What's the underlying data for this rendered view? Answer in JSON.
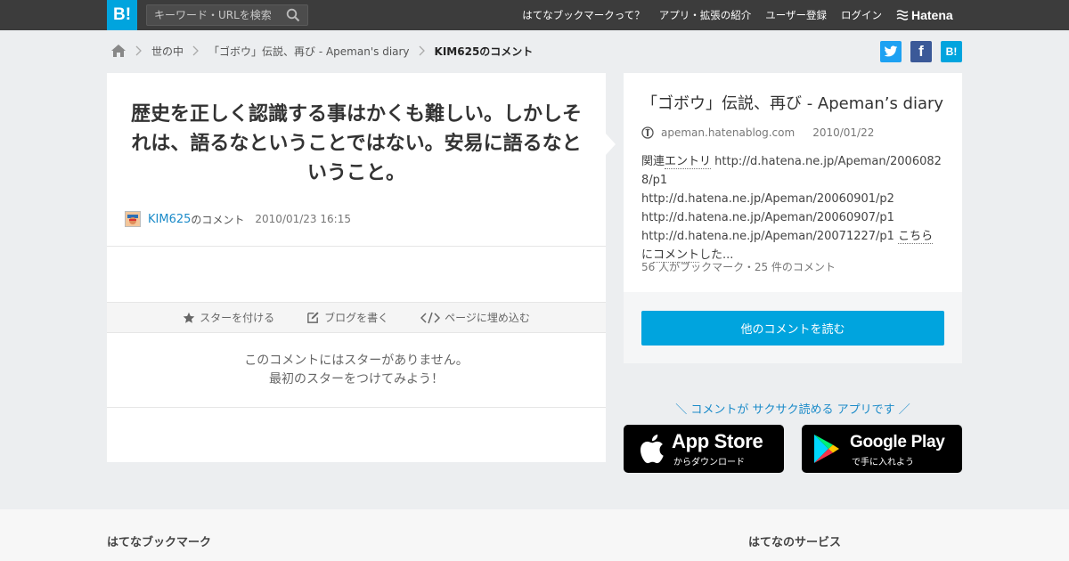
{
  "header": {
    "logo": "B!",
    "search_placeholder": "キーワード・URLを検索",
    "nav": [
      "はてなブックマークって？",
      "アプリ・拡張の紹介",
      "ユーザー登録",
      "ログイン"
    ],
    "brand": "Hatena"
  },
  "breadcrumb": {
    "items": [
      "世の中",
      "「ゴボウ」伝説、再び - Apeman's diary"
    ],
    "current": "KIM625のコメント"
  },
  "share": {
    "twitter": "twitter-icon",
    "facebook_label": "f",
    "hatebu_label": "B!"
  },
  "comment": {
    "text": "歴史を正しく認識する事はかくも難しい。しかしそれは、語るなということではない。安易に語るなということ。",
    "username": "KIM625",
    "suffix": "のコメント",
    "date": "2010/01/23 16:15"
  },
  "actions": {
    "star": "スターを付ける",
    "blog": "ブログを書く",
    "embed": "ページに埋め込む"
  },
  "nostar": {
    "line1": "このコメントにはスターがありません。",
    "line2": "最初のスターをつけてみよう！"
  },
  "entry": {
    "title": "「ゴボウ」伝説、再び - Apeman’s diary",
    "domain": "apeman.hatenablog.com",
    "date": "2010/01/22",
    "body": {
      "kw_related_prefix": "関連",
      "kw_entry": "エントリ",
      "url1": " http://d.hatena.ne.jp/Apeman/20060828/p1",
      "url2": "http://d.hatena.ne.jp/Apeman/20060901/p2",
      "url3": "http://d.hatena.ne.jp/Apeman/20060907/p1",
      "url4": "http://d.hatena.ne.jp/Apeman/20071227/p1 ",
      "kw_kochira": "こちら",
      "ni": "に",
      "kw_comment": "コメント",
      "tail": "した..."
    },
    "stats": "56 人がブックマーク・25 件のコメント",
    "read_button": "他のコメントを読む"
  },
  "promo": {
    "text": "＼ コメントが サクサク読める アプリです ／",
    "appstore_big": "App Store",
    "appstore_small": "からダウンロード",
    "googleplay_big": "Google Play",
    "googleplay_small": "で手に入れよう"
  },
  "footer": {
    "left": "はてなブックマーク",
    "right": "はてなのサービス"
  }
}
